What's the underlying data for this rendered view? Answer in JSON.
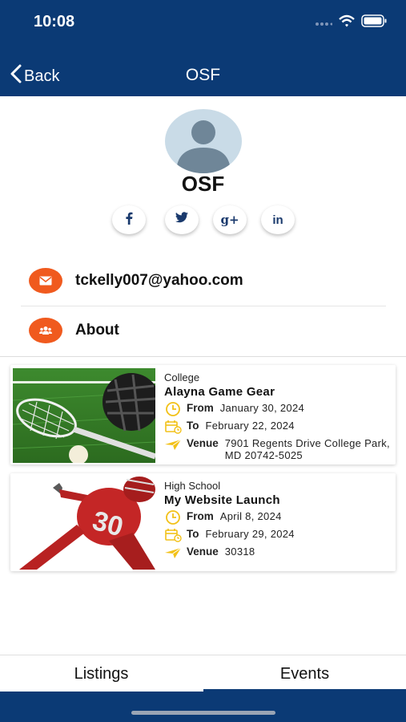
{
  "status": {
    "time": "10:08"
  },
  "nav": {
    "back_label": "Back",
    "title": "OSF"
  },
  "profile": {
    "name": "OSF"
  },
  "social": [
    {
      "icon": "facebook-icon",
      "glyph": "f"
    },
    {
      "icon": "twitter-icon",
      "glyph": "t"
    },
    {
      "icon": "google-plus-icon",
      "glyph": "g+"
    },
    {
      "icon": "linkedin-icon",
      "glyph": "in"
    }
  ],
  "contact": {
    "email": "tckelly007@yahoo.com",
    "about_label": "About"
  },
  "colors": {
    "brand": "#0b3a75",
    "accent": "#f05a1e",
    "icon_yellow": "#f2c118"
  },
  "events": [
    {
      "category": "College",
      "title": "Alayna Game Gear",
      "from_label": "From",
      "from": "January 30, 2024",
      "to_label": "To",
      "to": "February 22, 2024",
      "venue_label": "Venue",
      "venue": "7901 Regents Drive College Park, MD 20742-5025"
    },
    {
      "category": "High School",
      "title": "My Website Launch",
      "from_label": "From",
      "from": "April 8, 2024",
      "to_label": "To",
      "to": "February 29, 2024",
      "venue_label": "Venue",
      "venue": "30318"
    }
  ],
  "tabs": {
    "listings": "Listings",
    "events": "Events",
    "active": "Events"
  }
}
